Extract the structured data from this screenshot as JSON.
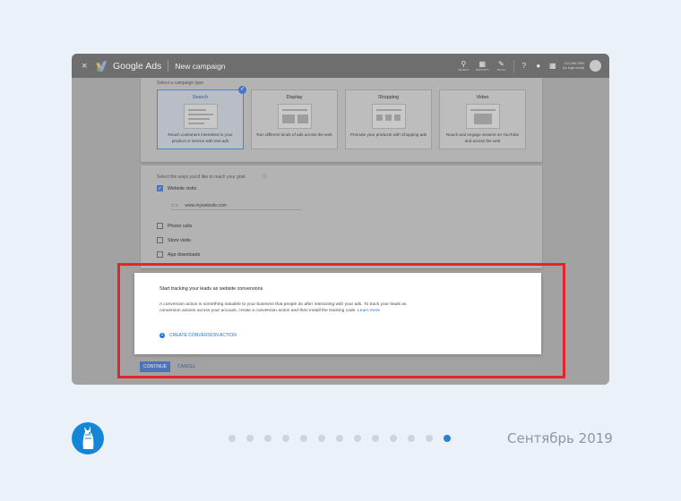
{
  "app": {
    "close_glyph": "×",
    "brand": "Google Ads",
    "page_title": "New campaign"
  },
  "toolbar": {
    "tools": [
      {
        "icon": "search-icon",
        "glyph": "⚲",
        "label": "SEARCH"
      },
      {
        "icon": "reports-icon",
        "glyph": "▦",
        "label": "REPORTS"
      },
      {
        "icon": "tools-icon",
        "glyph": "✎",
        "label": "TOOLS"
      }
    ],
    "account_number": "123-456-7890",
    "account_email": "[no login email]"
  },
  "campaign_type": {
    "heading": "Select a campaign type",
    "types": [
      {
        "name": "Search",
        "desc": "Reach customers interested in your product or service with text ads",
        "selected": true
      },
      {
        "name": "Display",
        "desc": "Run different kinds of ads across the web",
        "selected": false
      },
      {
        "name": "Shopping",
        "desc": "Promote your products with Shopping ads",
        "selected": false
      },
      {
        "name": "Video",
        "desc": "Reach and engage viewers on YouTube and across the web",
        "selected": false
      }
    ]
  },
  "goals": {
    "heading": "Select the ways you'd like to reach your goal",
    "website_visits": "Website visits",
    "website_checked": true,
    "url_value": "www.mywebsite.com",
    "phone_calls": "Phone calls",
    "store_visits": "Store visits",
    "app_downloads": "App downloads"
  },
  "conversion_panel": {
    "title": "Start tracking your leads as website conversions",
    "body": "A conversion action is something valuable to your business that people do after interacting with your ads. To track your leads as conversion actions across your account, create a conversion action and then install the tracking code.",
    "learn_more": "Learn more",
    "create_action": "CREATE CONVERSION ACTION"
  },
  "actions": {
    "continue": "CONTINUE",
    "cancel": "CANCEL"
  },
  "carousel": {
    "total": 13,
    "active_index": 12
  },
  "date": "Сентябрь 2019",
  "colors": {
    "background": "#eaf1f9",
    "highlight": "#e3242b",
    "accent": "#1a73e8",
    "active_dot": "#2a7fd4"
  }
}
